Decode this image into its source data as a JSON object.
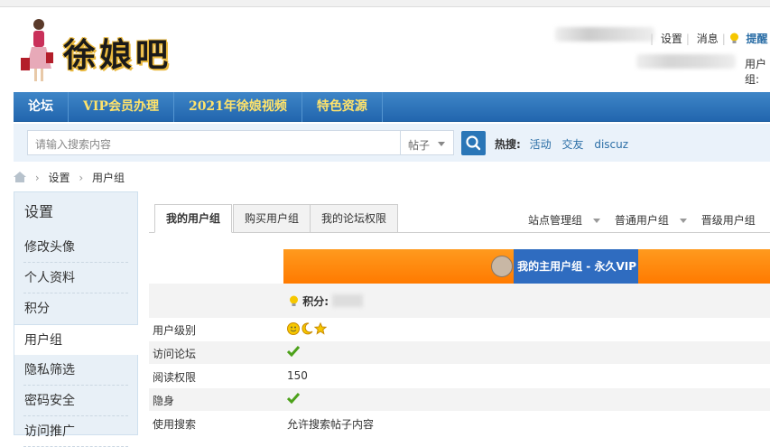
{
  "site": {
    "logo_text": "徐娘吧"
  },
  "topbar": {
    "settings": "设置",
    "messages": "消息",
    "remind": "提醒",
    "usergroup_label": "用户组:"
  },
  "mainnav": {
    "items": [
      "论坛",
      "VIP会员办理",
      "2021年徐娘视频",
      "特色资源"
    ]
  },
  "search": {
    "placeholder": "请输入搜索内容",
    "type": "帖子",
    "hot_label": "热搜:",
    "hot_items": [
      "活动",
      "交友",
      "discuz"
    ]
  },
  "breadcrumb": {
    "items": [
      "设置",
      "用户组"
    ]
  },
  "sidebar": {
    "title": "设置",
    "items": [
      "修改头像",
      "个人资料",
      "积分",
      "用户组",
      "隐私筛选",
      "密码安全",
      "访问推广"
    ],
    "active_index": 3
  },
  "tabs": {
    "items": [
      "我的用户组",
      "购买用户组",
      "我的论坛权限"
    ],
    "active_index": 0
  },
  "group_filters": [
    "站点管理组",
    "普通用户组",
    "晋级用户组"
  ],
  "group_panel": {
    "badge": "我的主用户组 - 永久VIP",
    "points_label": "积分:"
  },
  "permissions": {
    "rows": [
      {
        "label": "用户级别",
        "type": "icons",
        "value": ""
      },
      {
        "label": "访问论坛",
        "type": "check",
        "value": ""
      },
      {
        "label": "阅读权限",
        "type": "text",
        "value": "150"
      },
      {
        "label": "隐身",
        "type": "check",
        "value": ""
      },
      {
        "label": "使用搜索",
        "type": "text",
        "value": "允许搜索帖子内容"
      }
    ]
  },
  "colors": {
    "nav_blue": "#2266ae",
    "vip_yellow": "#ffe36b",
    "orange": "#ff8a0d",
    "badge_blue": "#2f6cc0",
    "check_green": "#4ca11a"
  }
}
